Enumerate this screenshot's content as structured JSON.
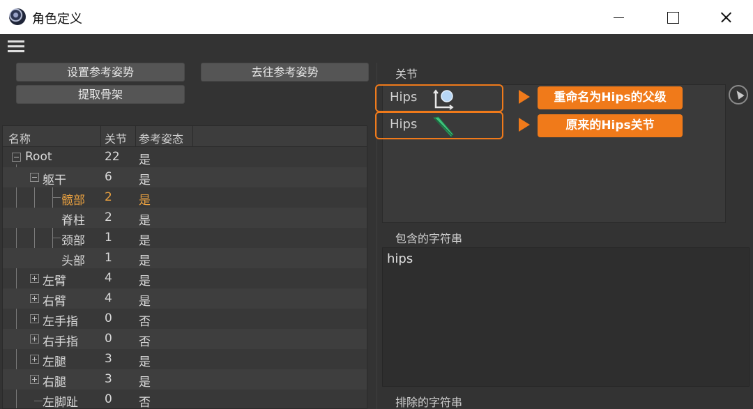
{
  "window": {
    "title": "角色定义"
  },
  "buttons": {
    "set_reference_pose": "设置参考姿势",
    "goto_reference_pose": "去往参考姿势",
    "extract_skeleton": "提取骨架"
  },
  "tree": {
    "columns": [
      "名称",
      "关节",
      "参考姿态"
    ],
    "rows": [
      {
        "name": "Root",
        "joints": "22",
        "pose": "是"
      },
      {
        "name": "躯干",
        "joints": "6",
        "pose": "是"
      },
      {
        "name": "髋部",
        "joints": "2",
        "pose": "是"
      },
      {
        "name": "脊柱",
        "joints": "2",
        "pose": "是"
      },
      {
        "name": "颈部",
        "joints": "1",
        "pose": "是"
      },
      {
        "name": "头部",
        "joints": "1",
        "pose": "是"
      },
      {
        "name": "左臂",
        "joints": "4",
        "pose": "是"
      },
      {
        "name": "右臂",
        "joints": "4",
        "pose": "是"
      },
      {
        "name": "左手指",
        "joints": "0",
        "pose": "否"
      },
      {
        "name": "右手指",
        "joints": "0",
        "pose": "否"
      },
      {
        "name": "左腿",
        "joints": "3",
        "pose": "是"
      },
      {
        "name": "右腿",
        "joints": "3",
        "pose": "是"
      },
      {
        "name": "左脚趾",
        "joints": "0",
        "pose": "否"
      }
    ]
  },
  "joints_panel": {
    "label": "关节",
    "items": [
      {
        "name": "Hips",
        "icon": "null-object-icon",
        "callout": "重命名为Hips的父级"
      },
      {
        "name": "Hips",
        "icon": "joint-bone-icon",
        "callout": "原来的Hips关节"
      }
    ]
  },
  "include_strings": {
    "label": "包含的字符串",
    "value": "hips"
  },
  "exclude_strings": {
    "label": "排除的字符串"
  },
  "colors": {
    "accent": "#f07a1a",
    "selected_text": "#e8a040",
    "panel_bg": "#333333"
  }
}
